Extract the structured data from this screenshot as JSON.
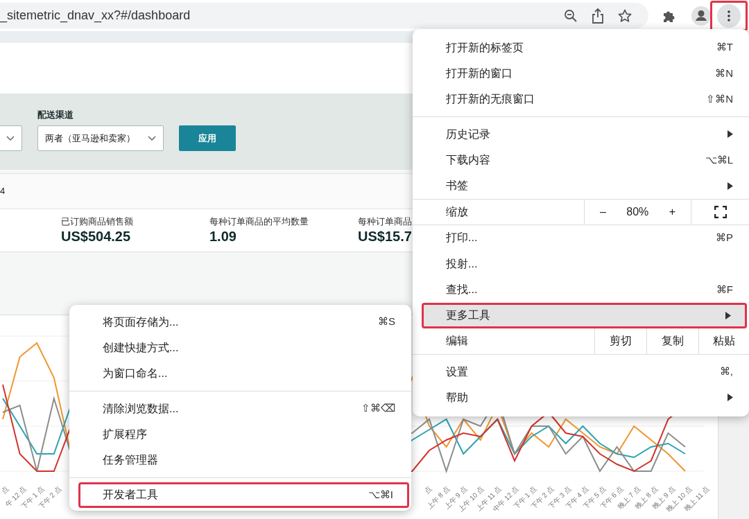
{
  "address_bar": {
    "url": "_sitemetric_dnav_xx?#/dashboard"
  },
  "menu_button": {
    "active": true,
    "outlined": true
  },
  "filters": {
    "label": "配送渠道",
    "select_value": "两者（亚马逊和卖家）",
    "apply_button": "应用"
  },
  "date_fragment": "4",
  "metrics": [
    {
      "label": "已订购商品销售额",
      "value": "US$504.25"
    },
    {
      "label": "每种订单商品的平均数量",
      "value": "1.09"
    },
    {
      "label": "每种订单商品",
      "value": "US$15.7"
    }
  ],
  "chart": {
    "x_labels_left": [
      "点",
      "午 12 点",
      "下午 1 点",
      "下午 2 点"
    ],
    "x_labels_right": [
      "点",
      "上午 8 点",
      "上午 9 点",
      "上午 10 点",
      "上午 11 点",
      "中午 12 点",
      "下午 1 点",
      "下午 2 点",
      "下午 3 点",
      "下午 4 点",
      "下午 5 点",
      "下午 6 点",
      "晚上 7 点",
      "晚上 8 点",
      "晚上 9 点",
      "晚上 10 点",
      "晚上 11 点"
    ]
  },
  "main_menu": [
    {
      "kind": "item",
      "label": "打开新的标签页",
      "shortcut": "⌘T",
      "submenu": false,
      "selected": false,
      "outlined": false
    },
    {
      "kind": "item",
      "label": "打开新的窗口",
      "shortcut": "⌘N",
      "submenu": false,
      "selected": false,
      "outlined": false
    },
    {
      "kind": "item",
      "label": "打开新的无痕窗口",
      "shortcut": "⇧⌘N",
      "submenu": false,
      "selected": false,
      "outlined": false
    },
    {
      "kind": "separator"
    },
    {
      "kind": "item",
      "label": "历史记录",
      "submenu": true,
      "selected": false,
      "outlined": false
    },
    {
      "kind": "item",
      "label": "下载内容",
      "shortcut": "⌥⌘L",
      "submenu": false,
      "selected": false,
      "outlined": false
    },
    {
      "kind": "item",
      "label": "书签",
      "submenu": true,
      "selected": false,
      "outlined": false
    },
    {
      "kind": "zoom",
      "label": "缩放",
      "minus": "–",
      "level_text": "80%",
      "plus": "+"
    },
    {
      "kind": "item",
      "label": "打印...",
      "shortcut": "⌘P",
      "submenu": false,
      "selected": false,
      "outlined": false
    },
    {
      "kind": "item",
      "label": "投射...",
      "submenu": false,
      "selected": false,
      "outlined": false
    },
    {
      "kind": "item",
      "label": "查找...",
      "shortcut": "⌘F",
      "submenu": false,
      "selected": false,
      "outlined": false
    },
    {
      "kind": "item",
      "label": "更多工具",
      "submenu": true,
      "selected": true,
      "outlined": true
    },
    {
      "kind": "edit",
      "label": "编辑",
      "actions": [
        "剪切",
        "复制",
        "粘贴"
      ]
    },
    {
      "kind": "item",
      "label": "设置",
      "shortcut": "⌘,",
      "submenu": false,
      "selected": false,
      "outlined": false
    },
    {
      "kind": "item",
      "label": "帮助",
      "submenu": true,
      "selected": false,
      "outlined": false
    }
  ],
  "sub_menu": [
    {
      "kind": "item",
      "label": "将页面存储为...",
      "shortcut": "⌘S",
      "submenu": false,
      "selected": false,
      "outlined": false
    },
    {
      "kind": "item",
      "label": "创建快捷方式...",
      "submenu": false,
      "selected": false,
      "outlined": false
    },
    {
      "kind": "item",
      "label": "为窗口命名...",
      "submenu": false,
      "selected": false,
      "outlined": false
    },
    {
      "kind": "separator"
    },
    {
      "kind": "item",
      "label": "清除浏览数据...",
      "shortcut": "⇧⌘⌫",
      "submenu": false,
      "selected": false,
      "outlined": false
    },
    {
      "kind": "item",
      "label": "扩展程序",
      "submenu": false,
      "selected": false,
      "outlined": false
    },
    {
      "kind": "item",
      "label": "任务管理器",
      "submenu": false,
      "selected": false,
      "outlined": false
    },
    {
      "kind": "separator"
    },
    {
      "kind": "item",
      "label": "开发者工具",
      "shortcut": "⌥⌘I",
      "submenu": false,
      "selected": false,
      "outlined": true
    }
  ]
}
